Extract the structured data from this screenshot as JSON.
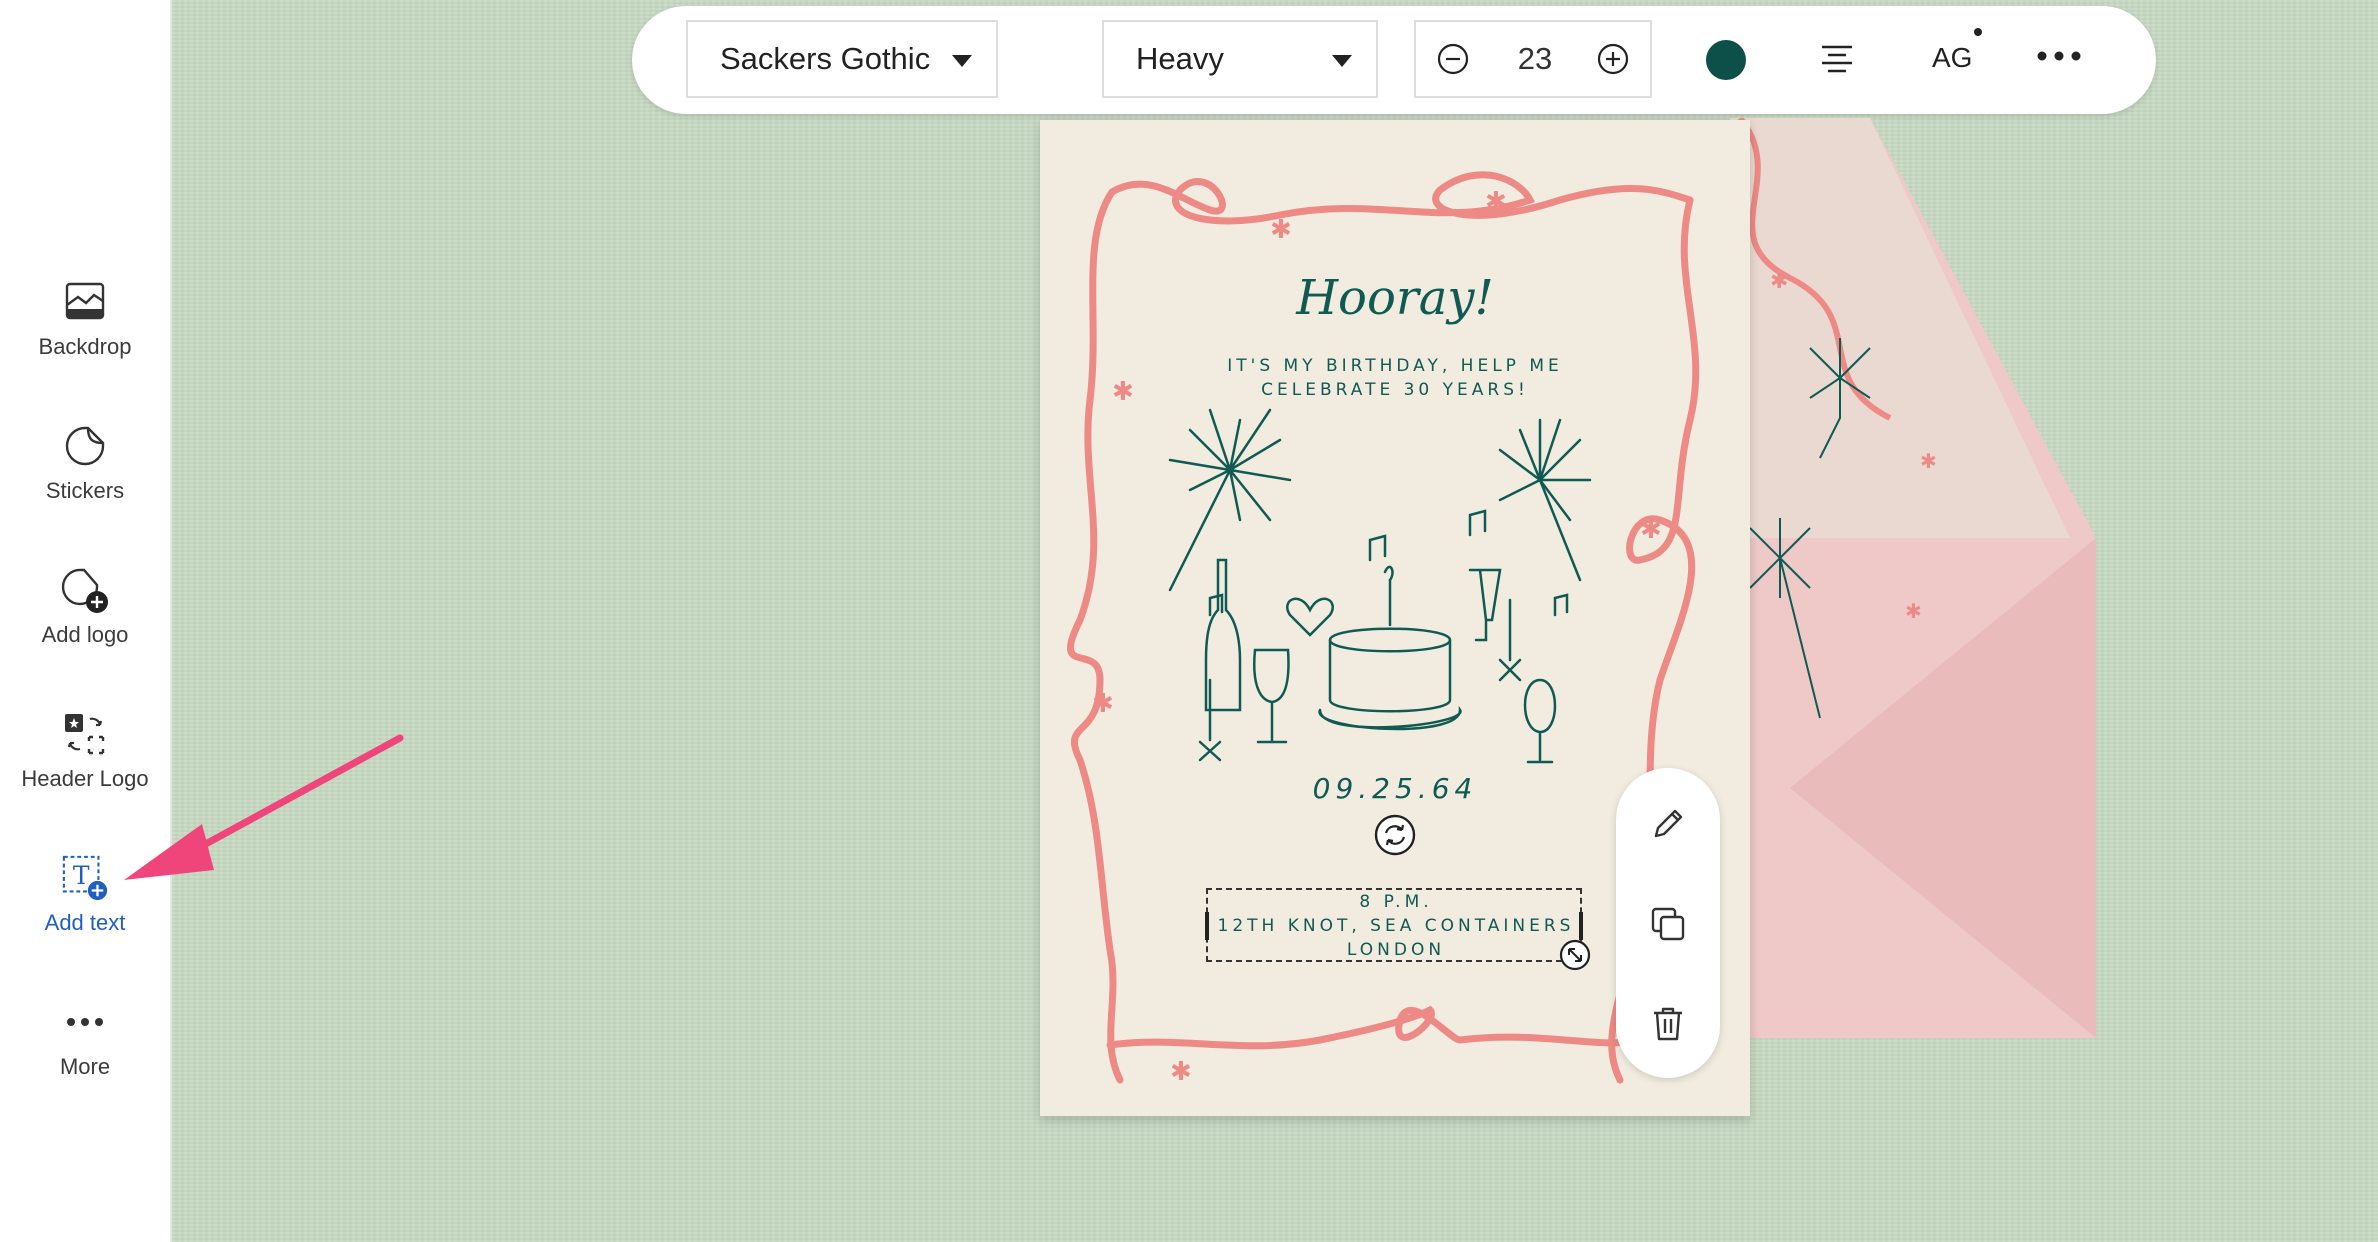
{
  "sidebar": {
    "items": [
      {
        "label": "Backdrop",
        "icon": "backdrop-icon"
      },
      {
        "label": "Stickers",
        "icon": "sticker-icon"
      },
      {
        "label": "Add logo",
        "icon": "add-logo-icon"
      },
      {
        "label": "Header Logo",
        "icon": "header-logo-icon"
      },
      {
        "label": "Add text",
        "icon": "add-text-icon",
        "active": true
      },
      {
        "label": "More",
        "icon": "more-icon"
      }
    ]
  },
  "toolbar": {
    "font_family": "Sackers Gothic",
    "font_weight": "Heavy",
    "font_size": "23",
    "text_color": "#0d4f49",
    "ag_label": "AG"
  },
  "card": {
    "headline": "Hooray!",
    "subtitle_line1": "IT'S MY BIRTHDAY, HELP ME",
    "subtitle_line2": "CELEBRATE 30 YEARS!",
    "date": "09.25.64",
    "details_line1": "8 P.M.",
    "details_line2": "12TH KNOT, SEA CONTAINERS",
    "details_line3": "LONDON"
  },
  "colors": {
    "accent": "#1f5fc1",
    "arrow": "#f0457a",
    "card_bg": "#f1ecdf",
    "ink": "#0f5a52",
    "ribbon": "#ee8a85",
    "envelope": "#efc8c8",
    "canvas": "#c6d8c1"
  }
}
